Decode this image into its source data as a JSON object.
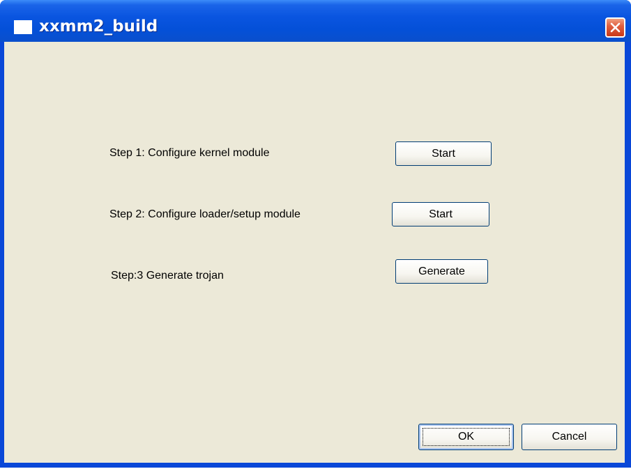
{
  "window": {
    "title": "xxmm2_build"
  },
  "steps": [
    {
      "label": "Step 1: Configure kernel module",
      "button": "Start"
    },
    {
      "label": "Step 2: Configure loader/setup module",
      "button": "Start"
    },
    {
      "label": "Step:3 Generate trojan",
      "button": "Generate"
    }
  ],
  "footer": {
    "ok_label": "OK",
    "cancel_label": "Cancel"
  },
  "icons": {
    "close": "close-icon",
    "app": "window-icon"
  },
  "colors": {
    "titlebar": "#0a55e0",
    "client_background": "#ece9d8",
    "close_button": "#e06040"
  }
}
